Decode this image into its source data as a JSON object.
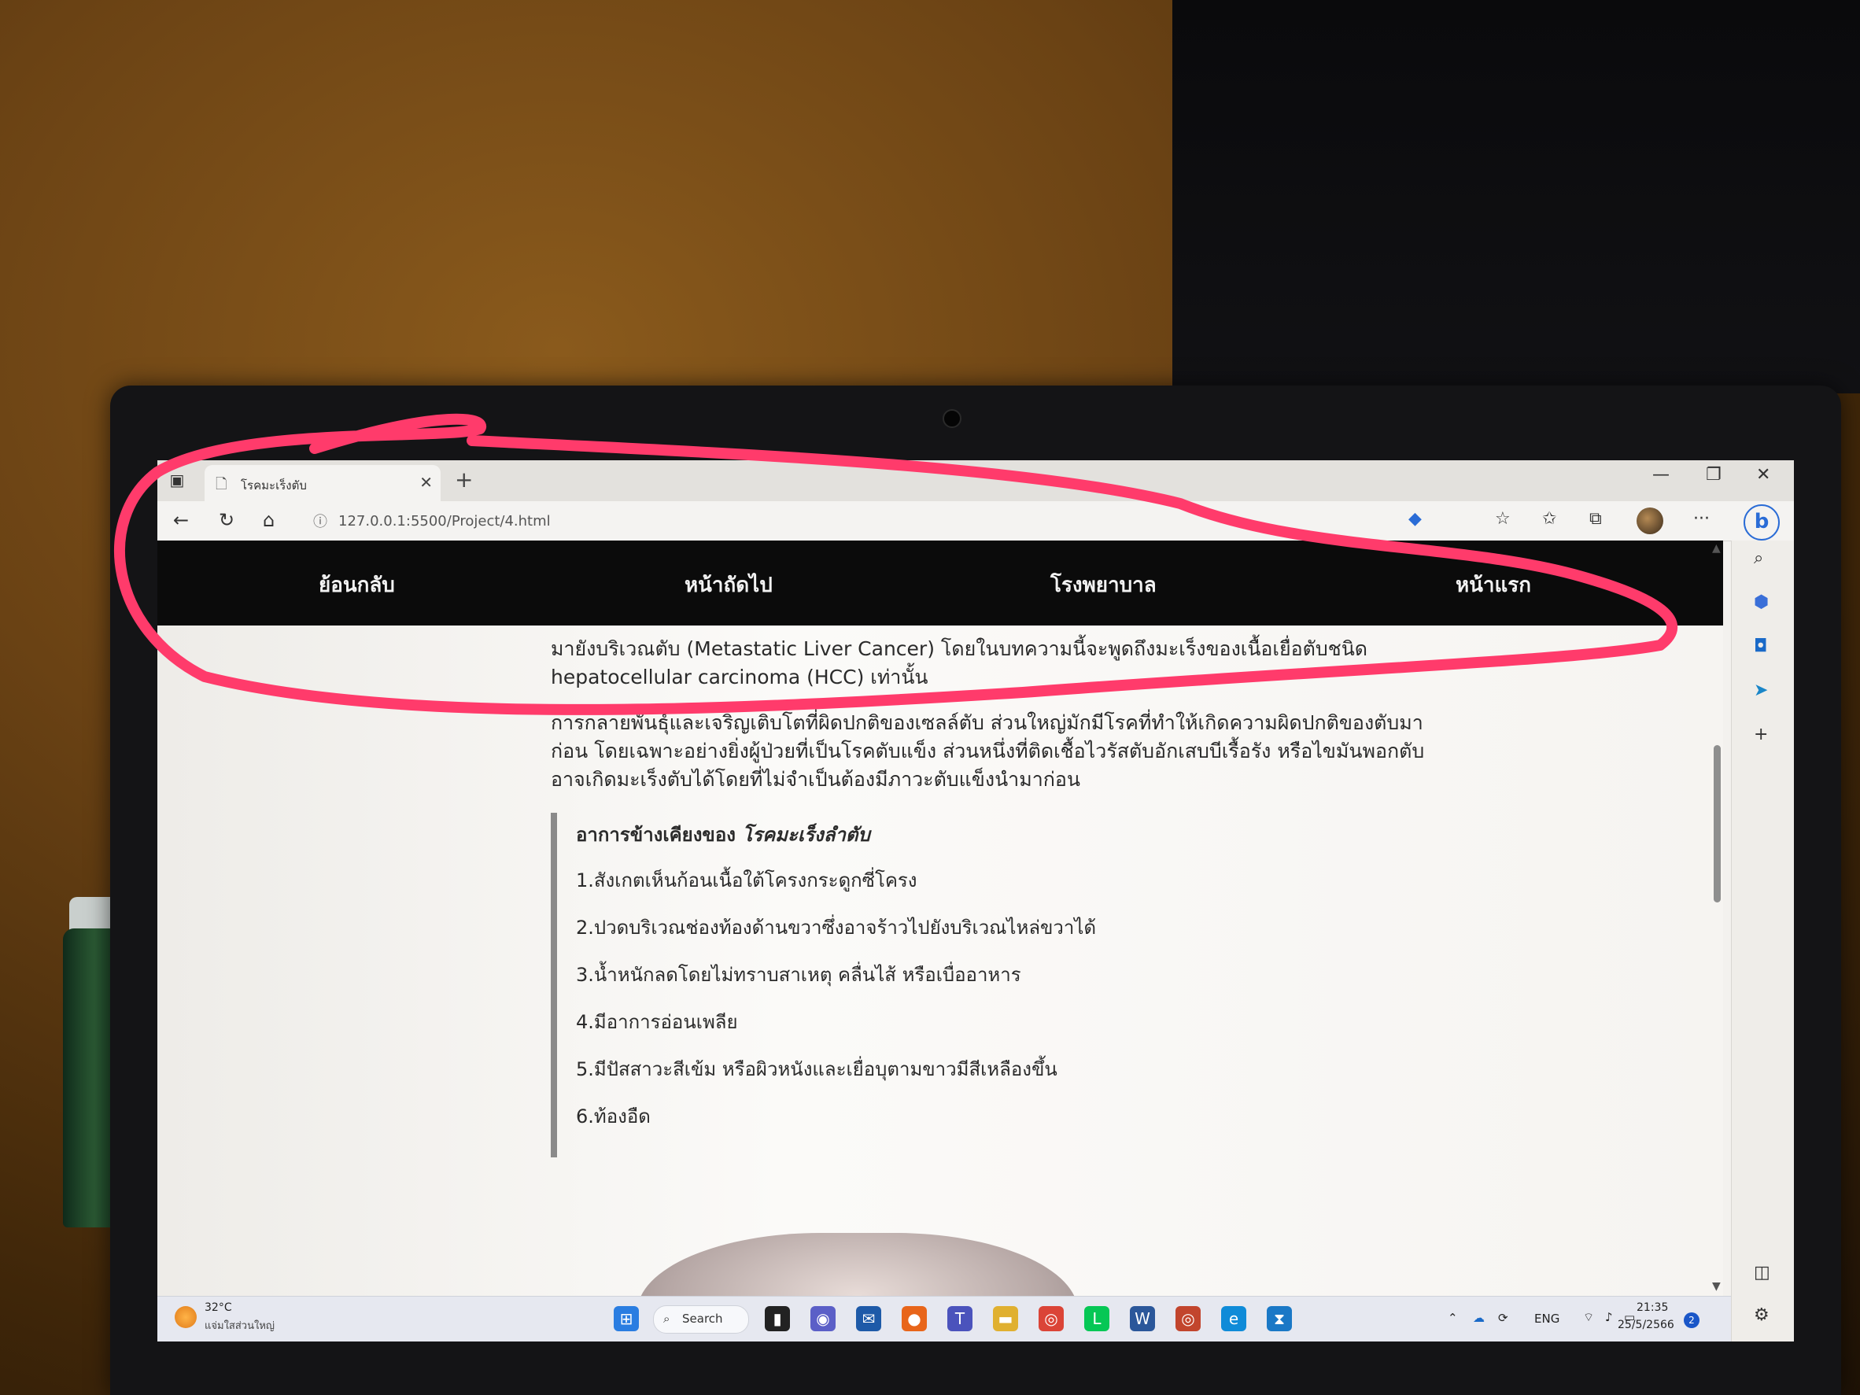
{
  "browser": {
    "tab_title": "โรคมะเร็งตับ",
    "tab_close": "✕",
    "new_tab": "+",
    "url": "127.0.0.1:5500/Project/4.html",
    "win_minimize": "—",
    "win_restore": "❐",
    "win_close": "✕",
    "more_menu": "···",
    "bing_label": "b"
  },
  "site_nav": {
    "items": [
      {
        "label": "ย้อนกลับ"
      },
      {
        "label": "หน้าถัดไป"
      },
      {
        "label": "โรงพยาบาล"
      },
      {
        "label": "หน้าแรก"
      }
    ]
  },
  "article": {
    "paragraphs": [
      "มายังบริเวณตับ (Metastatic Liver Cancer) โดยในบทความนี้จะพูดถึงมะเร็งของเนื้อเยื่อตับชนิด hepatocellular carcinoma (HCC) เท่านั้น",
      "การกลายพันธุ์และเจริญเติบโตที่ผิดปกติของเซลล์ตับ ส่วนใหญ่มักมีโรคที่ทำให้เกิดความผิดปกติของตับมาก่อน โดยเฉพาะอย่างยิ่งผู้ป่วยที่เป็นโรคตับแข็ง ส่วนหนึ่งที่ติดเชื้อไวรัสตับอักเสบบีเรื้อรัง หรือไขมันพอกตับ อาจเกิดมะเร็งตับได้โดยที่ไม่จำเป็นต้องมีภาวะตับแข็งนำมาก่อน"
    ],
    "symptoms": {
      "title_prefix": "อาการข้างเคียงของ",
      "title_em": "โรคมะเร็งลำตับ",
      "items": [
        "1.สังเกตเห็นก้อนเนื้อใต้โครงกระดูกซี่โครง",
        "2.ปวดบริเวณช่องท้องด้านขวาซึ่งอาจร้าวไปยังบริเวณไหล่ขวาได้",
        "3.น้ำหนักลดโดยไม่ทราบสาเหตุ คลื่นไส้ หรือเบื่ออาหาร",
        "4.มีอาการอ่อนเพลีย",
        "5.มีปัสสาวะสีเข้ม หรือผิวหนังและเยื่อบุตามขาวมีสีเหลืองขึ้น",
        "6.ท้องอืด"
      ]
    }
  },
  "taskbar": {
    "weather_temp": "32°C",
    "weather_desc": "แจ่มใสส่วนใหญ่",
    "search_label": "Search",
    "lang": "ENG",
    "time": "21:35",
    "date": "25/5/2566",
    "notifications": "2"
  },
  "colors": {
    "nav_bg": "#0b0b0b",
    "annotation": "#ff3b6b",
    "blockquote_border": "#8a8a8a"
  }
}
